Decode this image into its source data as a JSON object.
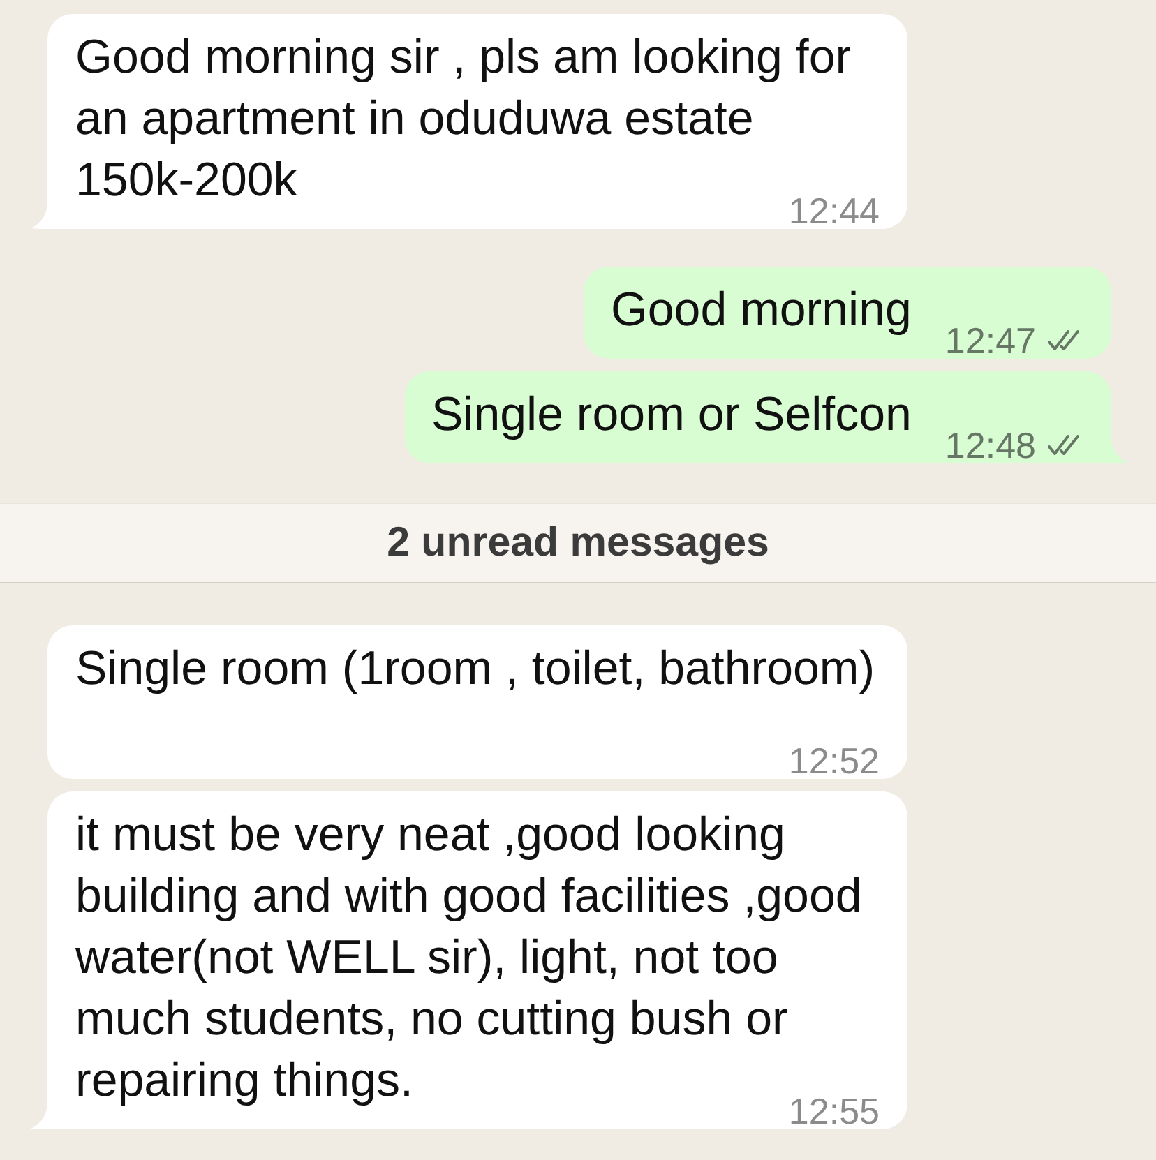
{
  "chat": [
    {
      "kind": "message",
      "outgoing": false,
      "text": "Good morning sir , pls am looking for an apartment in oduduwa estate 150k-200k",
      "time": "12:44",
      "tail": true
    },
    {
      "kind": "message",
      "outgoing": true,
      "text": "Good morning",
      "time": "12:47",
      "read": false,
      "tail": false
    },
    {
      "kind": "message",
      "outgoing": true,
      "text": "Single room or Selfcon",
      "time": "12:48",
      "read": false,
      "tail": true
    },
    {
      "kind": "unread_divider",
      "text": "2 unread messages"
    },
    {
      "kind": "message",
      "outgoing": false,
      "text": "Single room (1room , toilet, bathroom)",
      "time": "12:52",
      "tail": false
    },
    {
      "kind": "message",
      "outgoing": false,
      "text": "it must be very neat ,good looking building and with good facilities ,good water(not WELL sir), light, not too much students, no cutting bush or repairing things.",
      "time": "12:55",
      "tail": true
    }
  ]
}
